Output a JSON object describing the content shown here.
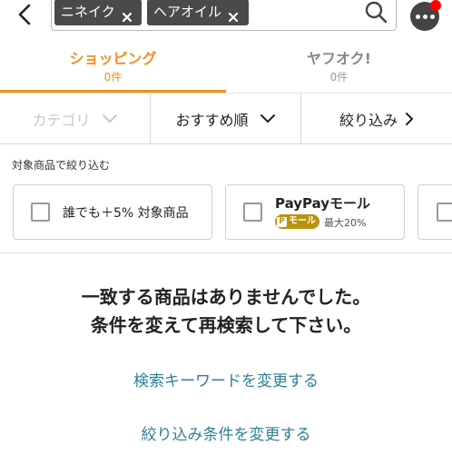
{
  "header": {
    "chips": [
      {
        "label": "ニネイク"
      },
      {
        "label": "ヘアオイル"
      }
    ],
    "back_icon": "chevron-left-icon",
    "search_icon": "search-icon",
    "more_icon": "more-dots-icon",
    "notification_color": "#ff0000"
  },
  "tabs": [
    {
      "name": "ショッピング",
      "count": "0件",
      "active": true
    },
    {
      "name": "ヤフオク!",
      "count": "0件",
      "active": false
    }
  ],
  "filter_bar": {
    "category": "カテゴリ",
    "sort": "おすすめ順",
    "narrow": "絞り込み"
  },
  "refine": {
    "title": "対象商品で絞り込む",
    "cards": [
      {
        "label": "誰でも＋5% 対象商品"
      },
      {
        "title": "PayPayモール",
        "badge_mark": "P",
        "badge_text": "モール",
        "sub": "最大20%"
      }
    ]
  },
  "empty": {
    "line1": "一致する商品はありませんでした。",
    "line2": "条件を変えて再検索して下さい。"
  },
  "links": {
    "keyword": "検索キーワードを変更する",
    "conditions": "絞り込み条件を変更する"
  },
  "colors": {
    "accent": "#f0901e",
    "link": "#2f7f96",
    "chip": "#4a4a4a",
    "badge": "#b8930d"
  }
}
